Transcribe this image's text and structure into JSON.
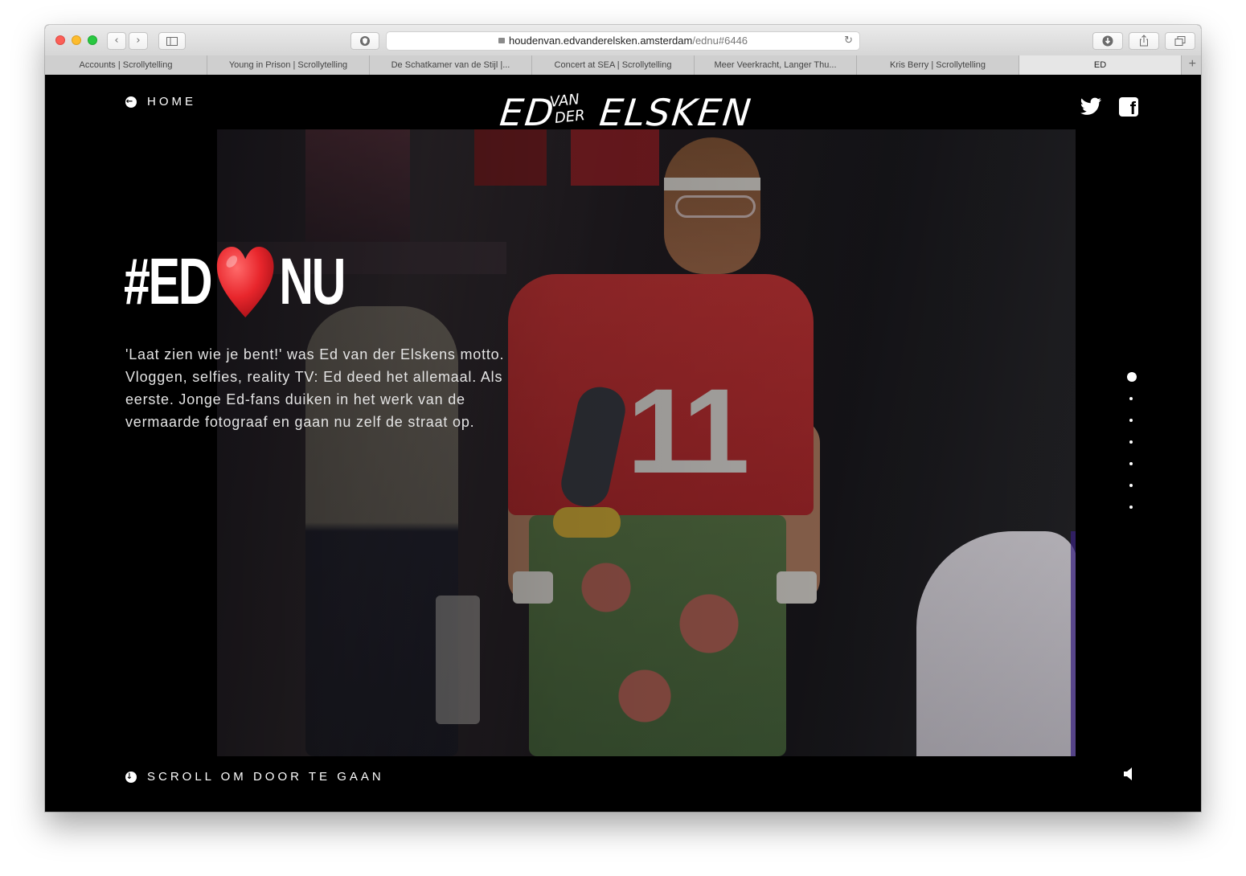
{
  "browser": {
    "url_domain": "houdenvan.edvanderelsken.amsterdam",
    "url_path": "/ednu#6446",
    "tabs": [
      {
        "label": "Accounts | Scrollytelling",
        "active": false
      },
      {
        "label": "Young in Prison | Scrollytelling",
        "active": false
      },
      {
        "label": "De Schatkamer van de Stijl |...",
        "active": false
      },
      {
        "label": "Concert at SEA | Scrollytelling",
        "active": false
      },
      {
        "label": "Meer Veerkracht, Langer Thu...",
        "active": false
      },
      {
        "label": "Kris Berry | Scrollytelling",
        "active": false
      },
      {
        "label": "ED",
        "active": true
      }
    ]
  },
  "header": {
    "home_label": "HOME",
    "logo": {
      "part1": "ED",
      "part2": "VAN",
      "part3": "DER",
      "part4": "ELSKEN"
    },
    "social": {
      "twitter_icon": "twitter-icon",
      "facebook_icon": "facebook-icon"
    }
  },
  "hero": {
    "title_before": "#ED",
    "title_heart_icon": "heart-icon",
    "title_after": "NU",
    "lead": " 'Laat zien wie je bent!' was Ed van der Elskens motto. Vloggen, selfies, reality TV: Ed deed het allemaal. Als eerste. Jonge Ed-fans duiken in het werk van de vermaarde fotograaf en gaan nu zelf de straat op."
  },
  "pager": {
    "count": 7,
    "active_index": 0
  },
  "footer": {
    "scroll_label": "SCROLL OM DOOR TE GAAN",
    "sound_icon": "speaker-icon"
  },
  "colors": {
    "background": "#000000",
    "text": "#ffffff",
    "heart": "#e8262c"
  }
}
